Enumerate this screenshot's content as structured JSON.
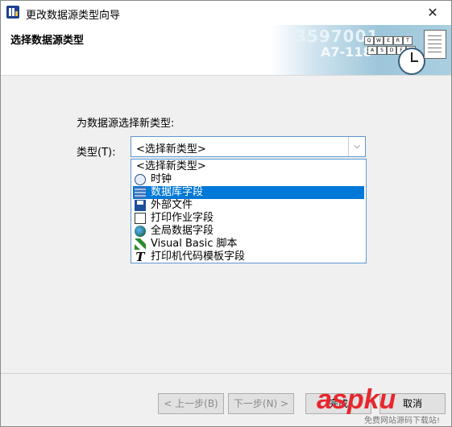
{
  "window": {
    "title": "更改数据源类型向导",
    "close_glyph": "✕"
  },
  "banner": {
    "title": "选择数据源类型",
    "art_digits": "3597001",
    "art_digits2": "A7-118",
    "art_keys_row1": [
      "Q",
      "W",
      "E",
      "R",
      "T"
    ],
    "art_keys_row2": [
      "A",
      "S",
      "D",
      "F",
      "G"
    ]
  },
  "form": {
    "prompt": "为数据源选择新类型:",
    "type_label": "类型(T):",
    "selected_value": "<选择新类型>",
    "dropdown_arrow": "⌵"
  },
  "options": [
    {
      "label": "<选择新类型>",
      "icon": "none"
    },
    {
      "label": "时钟",
      "icon": "clock-icon"
    },
    {
      "label": "数据库字段",
      "icon": "database-icon",
      "highlighted": true
    },
    {
      "label": "外部文件",
      "icon": "floppy-icon"
    },
    {
      "label": "打印作业字段",
      "icon": "print-job-icon"
    },
    {
      "label": "全局数据字段",
      "icon": "globe-icon"
    },
    {
      "label": "Visual Basic 脚本",
      "icon": "vb-script-icon"
    },
    {
      "label": "打印机代码模板字段",
      "icon": "text-template-icon"
    }
  ],
  "buttons": {
    "back": "< 上一步(B)",
    "next": "下一步(N) >",
    "finish": "完成",
    "cancel": "取消"
  },
  "watermark": {
    "logo": "aspku",
    "sub": "免费网站源码下载站!"
  },
  "colors": {
    "selection": "#0078d7",
    "focus_border": "#5b97d4"
  }
}
